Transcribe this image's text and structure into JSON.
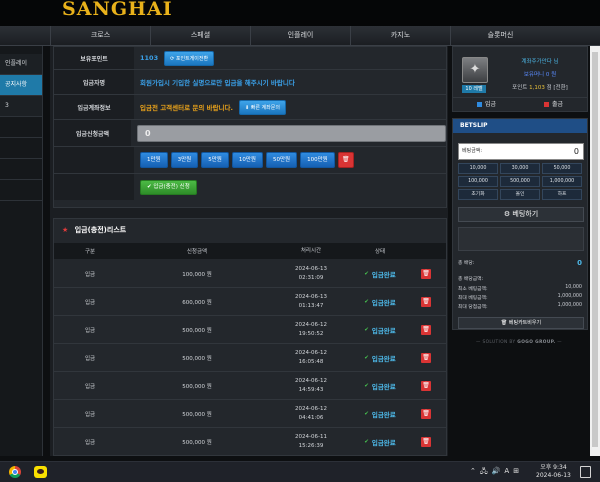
{
  "app": {
    "logo": "SANGHAI"
  },
  "nav": {
    "items": [
      "크로스",
      "스페셜",
      "인플레이",
      "카지노",
      "슬롯머신"
    ]
  },
  "sidebar": {
    "items": [
      "인플레이",
      "공지사항",
      "3"
    ]
  },
  "deposit_form": {
    "point_label": "보유포인트",
    "point_value": "1103",
    "point_button": "포인트게이전환",
    "depositor_label": "입금자명",
    "depositor_text": "회원가입시 기입한 실명으로만 입금을 해주시기 바랍니다",
    "account_label": "입금계좌정보",
    "account_text": "입금전 고객센터로 문의 바랍니다.",
    "account_button": "빠른 계좌문의",
    "amount_label": "입금신청금액",
    "amount_value": "0",
    "amount_buttons": [
      "1만원",
      "3만원",
      "5만원",
      "10만원",
      "50만원",
      "100만원"
    ],
    "apply_button": "입금(충전) 신청"
  },
  "deposit_list": {
    "title": "입금(충전)리스트",
    "columns": [
      "구분",
      "신청금액",
      "처리시간",
      "상태"
    ],
    "rows": [
      {
        "type": "입금",
        "amount": "100,000 원",
        "date": "2024-06-13",
        "time": "02:31:09",
        "status": "입금완료"
      },
      {
        "type": "입금",
        "amount": "600,000 원",
        "date": "2024-06-13",
        "time": "01:13:47",
        "status": "입금완료"
      },
      {
        "type": "입금",
        "amount": "500,000 원",
        "date": "2024-06-12",
        "time": "19:50:52",
        "status": "입금완료"
      },
      {
        "type": "입금",
        "amount": "500,000 원",
        "date": "2024-06-12",
        "time": "16:05:48",
        "status": "입금완료"
      },
      {
        "type": "입금",
        "amount": "500,000 원",
        "date": "2024-06-12",
        "time": "14:59:43",
        "status": "입금완료"
      },
      {
        "type": "입금",
        "amount": "500,000 원",
        "date": "2024-06-12",
        "time": "04:41:06",
        "status": "입금완료"
      },
      {
        "type": "입금",
        "amount": "500,000 원",
        "date": "2024-06-11",
        "time": "15:26:39",
        "status": "입금완료"
      }
    ]
  },
  "profile": {
    "nickname": "계좌주가안다 님",
    "money": "보유머니 0 원",
    "points_label": "포인트 ",
    "points_value": "1,103",
    "points_suffix": " 점 [전환]",
    "level": "10 레벨",
    "deposit": "입금",
    "withdraw": "출금"
  },
  "betslip": {
    "title": "BETSLIP",
    "amount_label": "베팅금액:",
    "amount_value": "0",
    "chips": [
      "10,000",
      "30,000",
      "50,000",
      "100,000",
      "500,000",
      "1,000,000",
      "초기화",
      "올인",
      "하프"
    ],
    "bet_button": "베팅하기",
    "total_odds_label": "총 배당:",
    "total_odds_value": "0",
    "expected_label": "총 배당금액:",
    "min_label": "최소 베팅금액:",
    "min_value": "10,000",
    "max_bet_label": "최대 베팅금액:",
    "max_bet_value": "1,000,000",
    "max_win_label": "최대 당첨금액:",
    "max_win_value": "1,000,000",
    "clear_button": "베팅카트비우기"
  },
  "footer": {
    "solution": "SOLUTION BY",
    "brand": "GOGO GROUP."
  },
  "taskbar": {
    "ime": "A",
    "period": "오후",
    "time": "9:34",
    "date": "2024-06-13"
  },
  "colors": {
    "accent": "#1f7aa8",
    "logo": "#e9b21b",
    "status": "#4db8e8",
    "danger": "#d93434",
    "success": "#3fa83a"
  }
}
